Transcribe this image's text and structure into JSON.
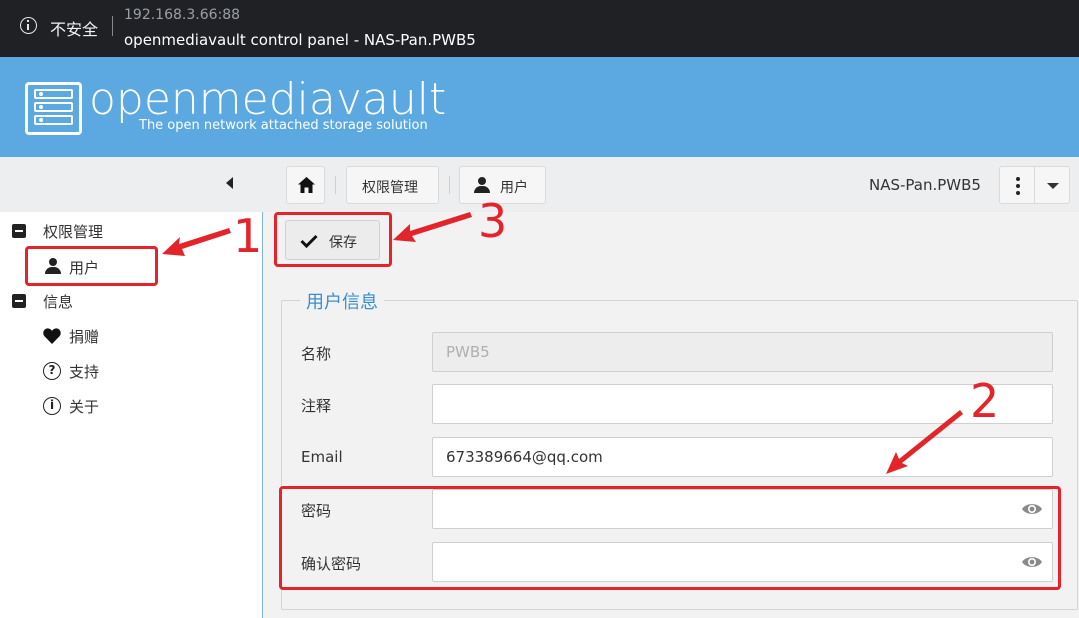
{
  "browser": {
    "security_label": "不安全",
    "url": "192.168.3.66:88",
    "page_title": "openmediavault control panel - NAS-Pan.PWB5"
  },
  "brand": {
    "name": "openmediavault",
    "tagline": "The open network attached storage solution",
    "color": "#5ba9e0"
  },
  "breadcrumb": {
    "home_icon": "home-icon",
    "items": [
      "权限管理",
      "用户"
    ]
  },
  "header": {
    "hostname": "NAS-Pan.PWB5"
  },
  "sidebar": {
    "groups": [
      {
        "label": "权限管理",
        "items": [
          {
            "label": "用户",
            "icon": "user-icon"
          }
        ]
      },
      {
        "label": "信息",
        "items": [
          {
            "label": "捐赠",
            "icon": "heart-icon"
          },
          {
            "label": "支持",
            "icon": "question-icon"
          },
          {
            "label": "关于",
            "icon": "info-icon"
          }
        ]
      }
    ]
  },
  "main": {
    "save_label": "保存",
    "section_title": "用户信息",
    "fields": [
      {
        "label": "名称",
        "value": "PWB5",
        "disabled": true
      },
      {
        "label": "注释",
        "value": ""
      },
      {
        "label": "Email",
        "value": "673389664@qq.com"
      },
      {
        "label": "密码",
        "value": "",
        "type": "password"
      },
      {
        "label": "确认密码",
        "value": "",
        "type": "password"
      }
    ]
  },
  "annotations": {
    "color": "#e3242b",
    "labels": [
      "1",
      "2",
      "3"
    ]
  }
}
